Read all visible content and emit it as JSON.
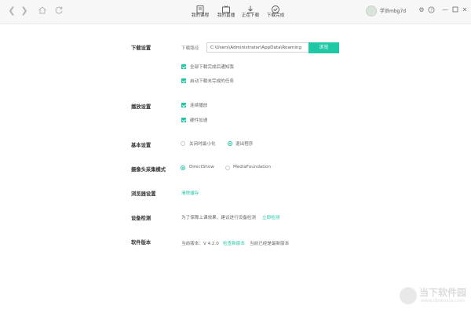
{
  "header": {
    "tabs": [
      {
        "label": "我的课程",
        "icon": "course-icon"
      },
      {
        "label": "我的直播",
        "icon": "live-icon"
      },
      {
        "label": "正在下载",
        "icon": "download-icon"
      },
      {
        "label": "下载完成",
        "icon": "check-circle-icon"
      }
    ],
    "username": "学员mbg7d",
    "accent": "#1ec8a5"
  },
  "download": {
    "title": "下载设置",
    "path_label": "下载路径",
    "path_value": "C:\\Users\\Administrator\\AppData\\Roaming",
    "browse_label": "浏览",
    "notify_label": "全部下载完成后通知我",
    "auto_resume_label": "启动下载未完成的任务"
  },
  "playback": {
    "title": "播放设置",
    "continuous_label": "连续播放",
    "hw_accel_label": "硬件加速"
  },
  "basic": {
    "title": "基本设置",
    "minimize_label": "关闭时最小化",
    "exit_label": "退出程序",
    "selected": "退出程序"
  },
  "camera": {
    "title": "摄像头采集模式",
    "directshow_label": "DirectShow",
    "mediafoundation_label": "MediaFoundation",
    "selected": "DirectShow"
  },
  "browser": {
    "title": "浏览器设置",
    "clear_cache_label": "清除缓存"
  },
  "device": {
    "title": "设备检测",
    "desc": "为了保障上课效果，建议进行设备检测",
    "check_now_label": "立即检测"
  },
  "version": {
    "title": "软件版本",
    "current_label": "当前版本：V 4.2.0",
    "check_update_label": "检查新版本",
    "status": "当前已经是最新版本"
  },
  "watermark": {
    "text": "当下软件园",
    "url": "www.downxia.com"
  }
}
